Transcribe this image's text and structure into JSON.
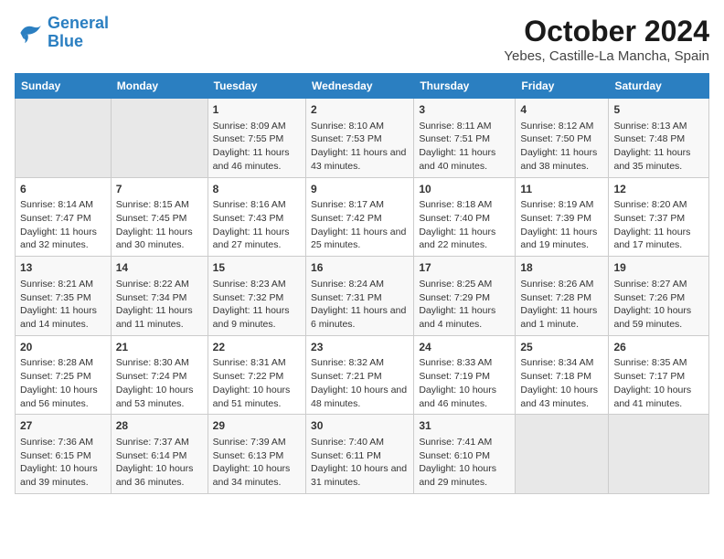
{
  "logo": {
    "line1": "General",
    "line2": "Blue"
  },
  "title": "October 2024",
  "subtitle": "Yebes, Castille-La Mancha, Spain",
  "headers": [
    "Sunday",
    "Monday",
    "Tuesday",
    "Wednesday",
    "Thursday",
    "Friday",
    "Saturday"
  ],
  "weeks": [
    [
      {
        "day": "",
        "empty": true
      },
      {
        "day": "",
        "empty": true
      },
      {
        "day": "1",
        "sunrise": "Sunrise: 8:09 AM",
        "sunset": "Sunset: 7:55 PM",
        "daylight": "Daylight: 11 hours and 46 minutes."
      },
      {
        "day": "2",
        "sunrise": "Sunrise: 8:10 AM",
        "sunset": "Sunset: 7:53 PM",
        "daylight": "Daylight: 11 hours and 43 minutes."
      },
      {
        "day": "3",
        "sunrise": "Sunrise: 8:11 AM",
        "sunset": "Sunset: 7:51 PM",
        "daylight": "Daylight: 11 hours and 40 minutes."
      },
      {
        "day": "4",
        "sunrise": "Sunrise: 8:12 AM",
        "sunset": "Sunset: 7:50 PM",
        "daylight": "Daylight: 11 hours and 38 minutes."
      },
      {
        "day": "5",
        "sunrise": "Sunrise: 8:13 AM",
        "sunset": "Sunset: 7:48 PM",
        "daylight": "Daylight: 11 hours and 35 minutes."
      }
    ],
    [
      {
        "day": "6",
        "sunrise": "Sunrise: 8:14 AM",
        "sunset": "Sunset: 7:47 PM",
        "daylight": "Daylight: 11 hours and 32 minutes."
      },
      {
        "day": "7",
        "sunrise": "Sunrise: 8:15 AM",
        "sunset": "Sunset: 7:45 PM",
        "daylight": "Daylight: 11 hours and 30 minutes."
      },
      {
        "day": "8",
        "sunrise": "Sunrise: 8:16 AM",
        "sunset": "Sunset: 7:43 PM",
        "daylight": "Daylight: 11 hours and 27 minutes."
      },
      {
        "day": "9",
        "sunrise": "Sunrise: 8:17 AM",
        "sunset": "Sunset: 7:42 PM",
        "daylight": "Daylight: 11 hours and 25 minutes."
      },
      {
        "day": "10",
        "sunrise": "Sunrise: 8:18 AM",
        "sunset": "Sunset: 7:40 PM",
        "daylight": "Daylight: 11 hours and 22 minutes."
      },
      {
        "day": "11",
        "sunrise": "Sunrise: 8:19 AM",
        "sunset": "Sunset: 7:39 PM",
        "daylight": "Daylight: 11 hours and 19 minutes."
      },
      {
        "day": "12",
        "sunrise": "Sunrise: 8:20 AM",
        "sunset": "Sunset: 7:37 PM",
        "daylight": "Daylight: 11 hours and 17 minutes."
      }
    ],
    [
      {
        "day": "13",
        "sunrise": "Sunrise: 8:21 AM",
        "sunset": "Sunset: 7:35 PM",
        "daylight": "Daylight: 11 hours and 14 minutes."
      },
      {
        "day": "14",
        "sunrise": "Sunrise: 8:22 AM",
        "sunset": "Sunset: 7:34 PM",
        "daylight": "Daylight: 11 hours and 11 minutes."
      },
      {
        "day": "15",
        "sunrise": "Sunrise: 8:23 AM",
        "sunset": "Sunset: 7:32 PM",
        "daylight": "Daylight: 11 hours and 9 minutes."
      },
      {
        "day": "16",
        "sunrise": "Sunrise: 8:24 AM",
        "sunset": "Sunset: 7:31 PM",
        "daylight": "Daylight: 11 hours and 6 minutes."
      },
      {
        "day": "17",
        "sunrise": "Sunrise: 8:25 AM",
        "sunset": "Sunset: 7:29 PM",
        "daylight": "Daylight: 11 hours and 4 minutes."
      },
      {
        "day": "18",
        "sunrise": "Sunrise: 8:26 AM",
        "sunset": "Sunset: 7:28 PM",
        "daylight": "Daylight: 11 hours and 1 minute."
      },
      {
        "day": "19",
        "sunrise": "Sunrise: 8:27 AM",
        "sunset": "Sunset: 7:26 PM",
        "daylight": "Daylight: 10 hours and 59 minutes."
      }
    ],
    [
      {
        "day": "20",
        "sunrise": "Sunrise: 8:28 AM",
        "sunset": "Sunset: 7:25 PM",
        "daylight": "Daylight: 10 hours and 56 minutes."
      },
      {
        "day": "21",
        "sunrise": "Sunrise: 8:30 AM",
        "sunset": "Sunset: 7:24 PM",
        "daylight": "Daylight: 10 hours and 53 minutes."
      },
      {
        "day": "22",
        "sunrise": "Sunrise: 8:31 AM",
        "sunset": "Sunset: 7:22 PM",
        "daylight": "Daylight: 10 hours and 51 minutes."
      },
      {
        "day": "23",
        "sunrise": "Sunrise: 8:32 AM",
        "sunset": "Sunset: 7:21 PM",
        "daylight": "Daylight: 10 hours and 48 minutes."
      },
      {
        "day": "24",
        "sunrise": "Sunrise: 8:33 AM",
        "sunset": "Sunset: 7:19 PM",
        "daylight": "Daylight: 10 hours and 46 minutes."
      },
      {
        "day": "25",
        "sunrise": "Sunrise: 8:34 AM",
        "sunset": "Sunset: 7:18 PM",
        "daylight": "Daylight: 10 hours and 43 minutes."
      },
      {
        "day": "26",
        "sunrise": "Sunrise: 8:35 AM",
        "sunset": "Sunset: 7:17 PM",
        "daylight": "Daylight: 10 hours and 41 minutes."
      }
    ],
    [
      {
        "day": "27",
        "sunrise": "Sunrise: 7:36 AM",
        "sunset": "Sunset: 6:15 PM",
        "daylight": "Daylight: 10 hours and 39 minutes."
      },
      {
        "day": "28",
        "sunrise": "Sunrise: 7:37 AM",
        "sunset": "Sunset: 6:14 PM",
        "daylight": "Daylight: 10 hours and 36 minutes."
      },
      {
        "day": "29",
        "sunrise": "Sunrise: 7:39 AM",
        "sunset": "Sunset: 6:13 PM",
        "daylight": "Daylight: 10 hours and 34 minutes."
      },
      {
        "day": "30",
        "sunrise": "Sunrise: 7:40 AM",
        "sunset": "Sunset: 6:11 PM",
        "daylight": "Daylight: 10 hours and 31 minutes."
      },
      {
        "day": "31",
        "sunrise": "Sunrise: 7:41 AM",
        "sunset": "Sunset: 6:10 PM",
        "daylight": "Daylight: 10 hours and 29 minutes."
      },
      {
        "day": "",
        "empty": true
      },
      {
        "day": "",
        "empty": true
      }
    ]
  ]
}
